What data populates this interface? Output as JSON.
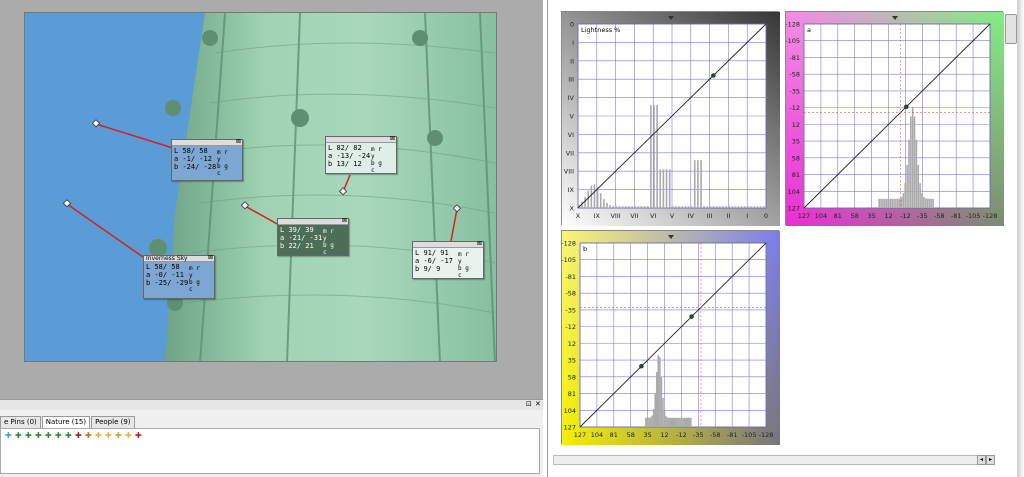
{
  "pins": [
    {
      "title": "",
      "L": "58/ 58",
      "a": "-1/ -12",
      "b": "-24/ -28"
    },
    {
      "title": "",
      "L": "82/ 82",
      "a": "-13/ -24",
      "b": "13/ 12"
    },
    {
      "title": "",
      "L": "39/ 39",
      "a": "-21/ -31",
      "b": "22/ 21"
    },
    {
      "title": "Inverness Sky",
      "L": "58/ 58",
      "a": "-0/ -11",
      "b": "-25/ -29"
    },
    {
      "title": "",
      "L": "91/ 91",
      "a": "-6/ -17",
      "b": "9/ 9"
    }
  ],
  "wheel_letters": {
    "r": "r",
    "m": "m",
    "y": "y",
    "b": "b",
    "g": "g",
    "c": "c"
  },
  "row_labels": {
    "L": "L",
    "a": "a",
    "b": "b"
  },
  "bottom_panel": {
    "tabs": [
      {
        "label": "e Pins (0)"
      },
      {
        "label": "Nature (15)"
      },
      {
        "label": "People (9)"
      }
    ],
    "pin_button": "⊡",
    "close_button": "✕",
    "pin_colors": [
      "#3aa0d8",
      "#2a8a2a",
      "#2a8a2a",
      "#2a8a2a",
      "#2a8a2a",
      "#2a8a2a",
      "#2a8a2a",
      "#a02020",
      "#d07010",
      "#e8b040",
      "#e8b040",
      "#d0a020",
      "#e8b040",
      "#c02020"
    ]
  },
  "curves": {
    "lightness": {
      "label": "Lightness %",
      "y_ticks": [
        "0",
        "I",
        "II",
        "III",
        "IV",
        "V",
        "VI",
        "VII",
        "VIII",
        "IX",
        "X"
      ],
      "x_ticks": [
        "X",
        "IX",
        "VIII",
        "VII",
        "VI",
        "V",
        "IV",
        "III",
        "II",
        "I",
        "0"
      ]
    },
    "a": {
      "label": "a",
      "y_ticks": [
        "-128",
        "-105",
        "-81",
        "-58",
        "-35",
        "-12",
        "12",
        "35",
        "58",
        "81",
        "104",
        "127"
      ],
      "x_ticks": [
        "127",
        "104",
        "81",
        "58",
        "35",
        "12",
        "-12",
        "-35",
        "-58",
        "-81",
        "-105",
        "-128"
      ]
    },
    "b": {
      "label": "b",
      "y_ticks": [
        "-128",
        "-105",
        "-81",
        "-58",
        "-35",
        "-12",
        "12",
        "35",
        "58",
        "81",
        "104",
        "127"
      ],
      "x_ticks": [
        "127",
        "104",
        "81",
        "58",
        "35",
        "12",
        "-12",
        "-35",
        "-58",
        "-81",
        "-105",
        "-128"
      ]
    }
  },
  "colors": {
    "sky": "#5b9bd6",
    "building": "#8fc9a6",
    "leader": "#d42020",
    "grid": "#7a7ae6",
    "magenta": "#ee2bd6",
    "green": "#1be01b",
    "yellow": "#f5f000",
    "blue": "#1010e0"
  },
  "icons": {
    "close": "close-icon",
    "pin": "pin-icon",
    "curve_marker": "triangle-marker-icon"
  }
}
